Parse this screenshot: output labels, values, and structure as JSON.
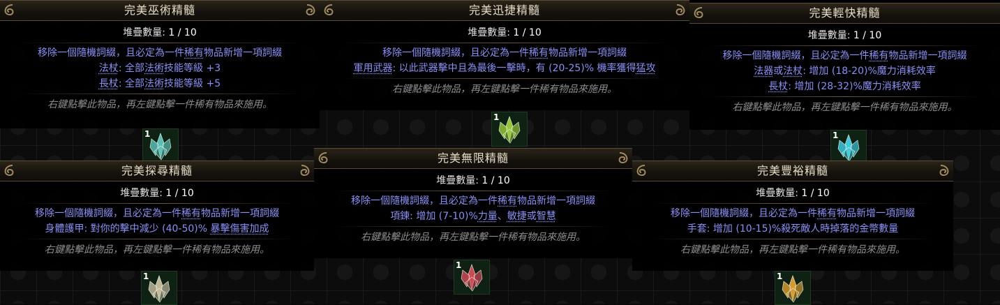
{
  "tooltips": [
    {
      "title": "完美巫術精髓",
      "stack_label": "堆疊數量:",
      "stack_value": "1 / 10",
      "lines": [
        {
          "segments": [
            {
              "t": "移除一個隨機詞綴，且必定為一件"
            },
            {
              "t": "稀有",
              "kw": true
            },
            {
              "t": "物品新增一項詞綴"
            }
          ]
        },
        {
          "segments": [
            {
              "t": "法杖",
              "kw": true
            },
            {
              "t": ": 全部"
            },
            {
              "t": "法術",
              "kw": true
            },
            {
              "t": "技能等級 +3"
            }
          ]
        },
        {
          "segments": [
            {
              "t": "長杖",
              "kw": true
            },
            {
              "t": ": 全部"
            },
            {
              "t": "法術",
              "kw": true
            },
            {
              "t": "技能等級 +5"
            }
          ]
        }
      ],
      "hint": "右鍵點擊此物品，再左鍵點擊一件稀有物品來施用。",
      "icon": {
        "qty": "1",
        "name": "sorcery-essence-icon",
        "color": "#5fc7c0"
      }
    },
    {
      "title": "完美迅捷精髓",
      "stack_label": "堆疊數量:",
      "stack_value": "1 / 10",
      "lines": [
        {
          "segments": [
            {
              "t": "移除一個隨機詞綴，且必定為一件"
            },
            {
              "t": "稀有",
              "kw": true
            },
            {
              "t": "物品新增一項詞綴"
            }
          ]
        },
        {
          "segments": [
            {
              "t": "軍用武器",
              "kw": true
            },
            {
              "t": ": 以此武器擊中且為最後一擊時，有 (20-25)% 機率獲得"
            },
            {
              "t": "猛攻",
              "kw": true
            }
          ]
        }
      ],
      "hint": "右鍵點擊此物品，再左鍵點擊一件稀有物品來施用。",
      "icon": {
        "qty": "1",
        "name": "haste-essence-icon",
        "color": "#9ccf3d"
      }
    },
    {
      "title": "完美輕快精髓",
      "stack_label": "堆疊數量:",
      "stack_value": "1 / 10",
      "lines": [
        {
          "segments": [
            {
              "t": "移除一個隨機詞綴，且必定為一件"
            },
            {
              "t": "稀有",
              "kw": true
            },
            {
              "t": "物品新增一項詞綴"
            }
          ]
        },
        {
          "segments": [
            {
              "t": "法器",
              "kw": true
            },
            {
              "t": "或"
            },
            {
              "t": "法杖",
              "kw": true
            },
            {
              "t": ": 增加 (18-20)%魔力消耗效率"
            }
          ]
        },
        {
          "segments": [
            {
              "t": "長杖",
              "kw": true
            },
            {
              "t": ": 增加 (28-32)%魔力消耗效率"
            }
          ]
        }
      ],
      "hint": "右鍵點擊此物品，再左鍵點擊一件稀有物品來施用。",
      "icon": {
        "qty": "1",
        "name": "alacrity-essence-icon",
        "color": "#3fd1e6"
      }
    },
    {
      "title": "完美探尋精髓",
      "stack_label": "堆疊數量:",
      "stack_value": "1 / 10",
      "lines": [
        {
          "segments": [
            {
              "t": "移除一個隨機詞綴，且必定為一件"
            },
            {
              "t": "稀有",
              "kw": true
            },
            {
              "t": "物品新增一項詞綴"
            }
          ]
        },
        {
          "segments": [
            {
              "t": "身體護甲: 對你的擊中減少 (40-50)% "
            },
            {
              "t": "暴擊傷害加成",
              "kw": true
            }
          ]
        }
      ],
      "hint": "右鍵點擊此物品，再左鍵點擊一件稀有物品來施用。",
      "icon": {
        "qty": "1",
        "name": "seeking-essence-icon",
        "color": "#c9bfa0"
      }
    },
    {
      "title": "完美無限精髓",
      "stack_label": "堆疊數量:",
      "stack_value": "1 / 10",
      "lines": [
        {
          "segments": [
            {
              "t": "移除一個隨機詞綴，且必定為一件"
            },
            {
              "t": "稀有",
              "kw": true
            },
            {
              "t": "物品新增一項詞綴"
            }
          ]
        },
        {
          "segments": [
            {
              "t": "項鍊: 增加 (7-10)%"
            },
            {
              "t": "力量",
              "kw": true
            },
            {
              "t": "、"
            },
            {
              "t": "敏捷",
              "kw": true
            },
            {
              "t": "或"
            },
            {
              "t": "智慧",
              "kw": true
            }
          ]
        }
      ],
      "hint": "右鍵點擊此物品，再左鍵點擊一件稀有物品來施用。",
      "icon": {
        "qty": "1",
        "name": "infinite-essence-icon",
        "color": "#d94b5a"
      }
    },
    {
      "title": "完美豐裕精髓",
      "stack_label": "堆疊數量:",
      "stack_value": "1 / 10",
      "lines": [
        {
          "segments": [
            {
              "t": "移除一個隨機詞綴，且必定為一件"
            },
            {
              "t": "稀有",
              "kw": true
            },
            {
              "t": "物品新增一項詞綴"
            }
          ]
        },
        {
          "segments": [
            {
              "t": "手套: 增加 (10-15)%殺死敵人時掉落的金幣數量"
            }
          ]
        }
      ],
      "hint": "右鍵點擊此物品，再左鍵點擊一件稀有物品來施用。",
      "icon": {
        "qty": "1",
        "name": "abundance-essence-icon",
        "color": "#e0a030"
      }
    }
  ]
}
